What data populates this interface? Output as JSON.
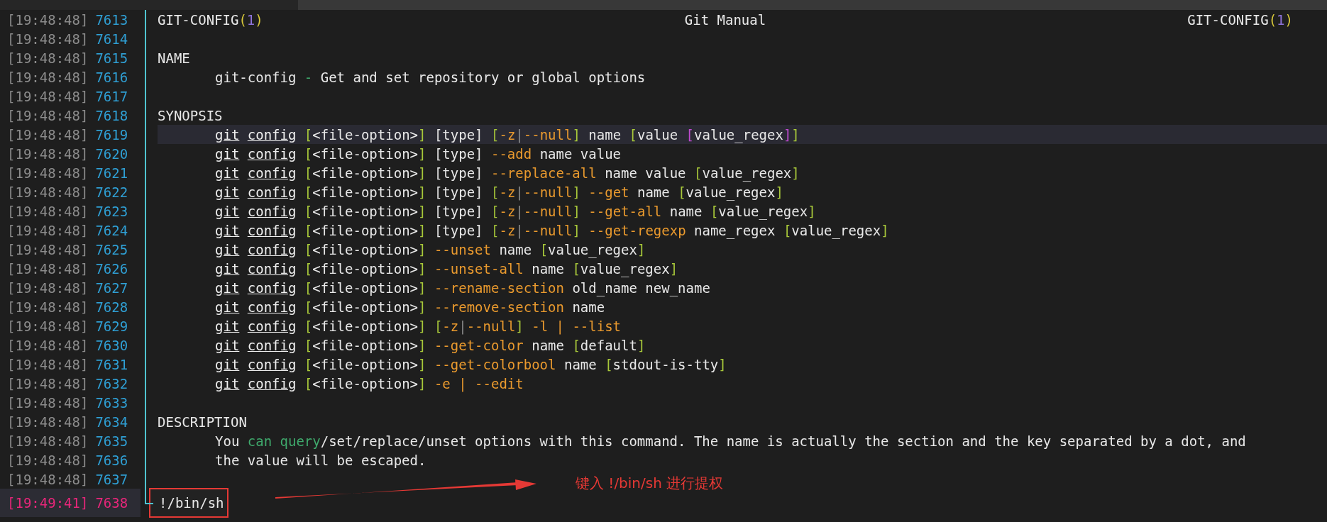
{
  "rows": [
    {
      "time": "[19:48:48]",
      "number": "7613",
      "kind": "header",
      "current": false,
      "highlighted": false,
      "header": [
        [
          {
            "kind": "text",
            "text": "GIT-CONFIG"
          },
          {
            "kind": "paren",
            "text": "("
          },
          {
            "kind": "num",
            "text": "1"
          },
          {
            "kind": "paren",
            "text": ")"
          }
        ],
        [
          {
            "kind": "text",
            "text": "Git Manual"
          }
        ],
        [
          {
            "kind": "text",
            "text": "GIT-CONFIG"
          },
          {
            "kind": "paren",
            "text": "("
          },
          {
            "kind": "num",
            "text": "1"
          },
          {
            "kind": "paren",
            "text": ")"
          }
        ]
      ]
    },
    {
      "time": "[19:48:48]",
      "number": "7614",
      "kind": "blank",
      "current": false,
      "highlighted": false
    },
    {
      "time": "[19:48:48]",
      "number": "7615",
      "kind": "text",
      "indented": false,
      "current": false,
      "highlighted": false,
      "segments": [
        {
          "kind": "text",
          "text": "NAME"
        }
      ]
    },
    {
      "time": "[19:48:48]",
      "number": "7616",
      "kind": "text",
      "indented": true,
      "current": false,
      "highlighted": false,
      "segments": [
        {
          "kind": "text",
          "text": "git-config "
        },
        {
          "kind": "green",
          "text": "-"
        },
        {
          "kind": "text",
          "text": " Get and set repository or global options"
        }
      ]
    },
    {
      "time": "[19:48:48]",
      "number": "7617",
      "kind": "blank",
      "current": false,
      "highlighted": false
    },
    {
      "time": "[19:48:48]",
      "number": "7618",
      "kind": "text",
      "indented": false,
      "current": false,
      "highlighted": false,
      "segments": [
        {
          "kind": "text",
          "text": "SYNOPSIS"
        }
      ]
    },
    {
      "time": "[19:48:48]",
      "number": "7619",
      "kind": "text",
      "indented": true,
      "current": false,
      "highlighted": true,
      "segments": [
        {
          "kind": "cmd",
          "text": "git"
        },
        {
          "kind": "cmd",
          "text": "config"
        },
        {
          "kind": "bracket",
          "text": "["
        },
        {
          "kind": "text",
          "text": "<file-option>"
        },
        {
          "kind": "bracket",
          "text": "]"
        },
        {
          "kind": "text",
          "text": " [type] "
        },
        {
          "kind": "bracket",
          "text": "["
        },
        {
          "kind": "option",
          "text": "-z"
        },
        {
          "kind": "dim",
          "text": "|"
        },
        {
          "kind": "option",
          "text": "--null"
        },
        {
          "kind": "bracket",
          "text": "]"
        },
        {
          "kind": "text",
          "text": " name "
        },
        {
          "kind": "bracket",
          "text": "["
        },
        {
          "kind": "text",
          "text": "value "
        },
        {
          "kind": "nested",
          "text": "["
        },
        {
          "kind": "text",
          "text": "value_regex"
        },
        {
          "kind": "nested",
          "text": "]"
        },
        {
          "kind": "bracket",
          "text": "]"
        }
      ]
    },
    {
      "time": "[19:48:48]",
      "number": "7620",
      "kind": "text",
      "indented": true,
      "current": false,
      "highlighted": false,
      "segments": [
        {
          "kind": "cmd",
          "text": "git"
        },
        {
          "kind": "cmd",
          "text": "config"
        },
        {
          "kind": "bracket",
          "text": "["
        },
        {
          "kind": "text",
          "text": "<file-option>"
        },
        {
          "kind": "bracket",
          "text": "]"
        },
        {
          "kind": "text",
          "text": " [type] "
        },
        {
          "kind": "option",
          "text": "--add"
        },
        {
          "kind": "text",
          "text": " name value"
        }
      ]
    },
    {
      "time": "[19:48:48]",
      "number": "7621",
      "kind": "text",
      "indented": true,
      "current": false,
      "highlighted": false,
      "segments": [
        {
          "kind": "cmd",
          "text": "git"
        },
        {
          "kind": "cmd",
          "text": "config"
        },
        {
          "kind": "bracket",
          "text": "["
        },
        {
          "kind": "text",
          "text": "<file-option>"
        },
        {
          "kind": "bracket",
          "text": "]"
        },
        {
          "kind": "text",
          "text": " [type] "
        },
        {
          "kind": "option",
          "text": "--replace-all"
        },
        {
          "kind": "text",
          "text": " name value "
        },
        {
          "kind": "bracket",
          "text": "["
        },
        {
          "kind": "text",
          "text": "value_regex"
        },
        {
          "kind": "bracket",
          "text": "]"
        }
      ]
    },
    {
      "time": "[19:48:48]",
      "number": "7622",
      "kind": "text",
      "indented": true,
      "current": false,
      "highlighted": false,
      "segments": [
        {
          "kind": "cmd",
          "text": "git"
        },
        {
          "kind": "cmd",
          "text": "config"
        },
        {
          "kind": "bracket",
          "text": "["
        },
        {
          "kind": "text",
          "text": "<file-option>"
        },
        {
          "kind": "bracket",
          "text": "]"
        },
        {
          "kind": "text",
          "text": " [type] "
        },
        {
          "kind": "bracket",
          "text": "["
        },
        {
          "kind": "option",
          "text": "-z"
        },
        {
          "kind": "dim",
          "text": "|"
        },
        {
          "kind": "option",
          "text": "--null"
        },
        {
          "kind": "bracket",
          "text": "]"
        },
        {
          "kind": "option",
          "text": " --get"
        },
        {
          "kind": "text",
          "text": " name "
        },
        {
          "kind": "bracket",
          "text": "["
        },
        {
          "kind": "text",
          "text": "value_regex"
        },
        {
          "kind": "bracket",
          "text": "]"
        }
      ]
    },
    {
      "time": "[19:48:48]",
      "number": "7623",
      "kind": "text",
      "indented": true,
      "current": false,
      "highlighted": false,
      "segments": [
        {
          "kind": "cmd",
          "text": "git"
        },
        {
          "kind": "cmd",
          "text": "config"
        },
        {
          "kind": "bracket",
          "text": "["
        },
        {
          "kind": "text",
          "text": "<file-option>"
        },
        {
          "kind": "bracket",
          "text": "]"
        },
        {
          "kind": "text",
          "text": " [type] "
        },
        {
          "kind": "bracket",
          "text": "["
        },
        {
          "kind": "option",
          "text": "-z"
        },
        {
          "kind": "dim",
          "text": "|"
        },
        {
          "kind": "option",
          "text": "--null"
        },
        {
          "kind": "bracket",
          "text": "]"
        },
        {
          "kind": "option",
          "text": " --get-all"
        },
        {
          "kind": "text",
          "text": " name "
        },
        {
          "kind": "bracket",
          "text": "["
        },
        {
          "kind": "text",
          "text": "value_regex"
        },
        {
          "kind": "bracket",
          "text": "]"
        }
      ]
    },
    {
      "time": "[19:48:48]",
      "number": "7624",
      "kind": "text",
      "indented": true,
      "current": false,
      "highlighted": false,
      "segments": [
        {
          "kind": "cmd",
          "text": "git"
        },
        {
          "kind": "cmd",
          "text": "config"
        },
        {
          "kind": "bracket",
          "text": "["
        },
        {
          "kind": "text",
          "text": "<file-option>"
        },
        {
          "kind": "bracket",
          "text": "]"
        },
        {
          "kind": "text",
          "text": " [type] "
        },
        {
          "kind": "bracket",
          "text": "["
        },
        {
          "kind": "option",
          "text": "-z"
        },
        {
          "kind": "dim",
          "text": "|"
        },
        {
          "kind": "option",
          "text": "--null"
        },
        {
          "kind": "bracket",
          "text": "]"
        },
        {
          "kind": "option",
          "text": " --get-regexp"
        },
        {
          "kind": "text",
          "text": " name_regex "
        },
        {
          "kind": "bracket",
          "text": "["
        },
        {
          "kind": "text",
          "text": "value_regex"
        },
        {
          "kind": "bracket",
          "text": "]"
        }
      ]
    },
    {
      "time": "[19:48:48]",
      "number": "7625",
      "kind": "text",
      "indented": true,
      "current": false,
      "highlighted": false,
      "segments": [
        {
          "kind": "cmd",
          "text": "git"
        },
        {
          "kind": "cmd",
          "text": "config"
        },
        {
          "kind": "bracket",
          "text": "["
        },
        {
          "kind": "text",
          "text": "<file-option>"
        },
        {
          "kind": "bracket",
          "text": "]"
        },
        {
          "kind": "option",
          "text": " --unset"
        },
        {
          "kind": "text",
          "text": " name "
        },
        {
          "kind": "bracket",
          "text": "["
        },
        {
          "kind": "text",
          "text": "value_regex"
        },
        {
          "kind": "bracket",
          "text": "]"
        }
      ]
    },
    {
      "time": "[19:48:48]",
      "number": "7626",
      "kind": "text",
      "indented": true,
      "current": false,
      "highlighted": false,
      "segments": [
        {
          "kind": "cmd",
          "text": "git"
        },
        {
          "kind": "cmd",
          "text": "config"
        },
        {
          "kind": "bracket",
          "text": "["
        },
        {
          "kind": "text",
          "text": "<file-option>"
        },
        {
          "kind": "bracket",
          "text": "]"
        },
        {
          "kind": "option",
          "text": " --unset-all"
        },
        {
          "kind": "text",
          "text": " name "
        },
        {
          "kind": "bracket",
          "text": "["
        },
        {
          "kind": "text",
          "text": "value_regex"
        },
        {
          "kind": "bracket",
          "text": "]"
        }
      ]
    },
    {
      "time": "[19:48:48]",
      "number": "7627",
      "kind": "text",
      "indented": true,
      "current": false,
      "highlighted": false,
      "segments": [
        {
          "kind": "cmd",
          "text": "git"
        },
        {
          "kind": "cmd",
          "text": "config"
        },
        {
          "kind": "bracket",
          "text": "["
        },
        {
          "kind": "text",
          "text": "<file-option>"
        },
        {
          "kind": "bracket",
          "text": "]"
        },
        {
          "kind": "option",
          "text": " --rename-section"
        },
        {
          "kind": "text",
          "text": " old_name new_name"
        }
      ]
    },
    {
      "time": "[19:48:48]",
      "number": "7628",
      "kind": "text",
      "indented": true,
      "current": false,
      "highlighted": false,
      "segments": [
        {
          "kind": "cmd",
          "text": "git"
        },
        {
          "kind": "cmd",
          "text": "config"
        },
        {
          "kind": "bracket",
          "text": "["
        },
        {
          "kind": "text",
          "text": "<file-option>"
        },
        {
          "kind": "bracket",
          "text": "]"
        },
        {
          "kind": "option",
          "text": " --remove-section"
        },
        {
          "kind": "text",
          "text": " name"
        }
      ]
    },
    {
      "time": "[19:48:48]",
      "number": "7629",
      "kind": "text",
      "indented": true,
      "current": false,
      "highlighted": false,
      "segments": [
        {
          "kind": "cmd",
          "text": "git"
        },
        {
          "kind": "cmd",
          "text": "config"
        },
        {
          "kind": "bracket",
          "text": "["
        },
        {
          "kind": "text",
          "text": "<file-option>"
        },
        {
          "kind": "bracket",
          "text": "] ["
        },
        {
          "kind": "option",
          "text": "-z"
        },
        {
          "kind": "dim",
          "text": "|"
        },
        {
          "kind": "option",
          "text": "--null"
        },
        {
          "kind": "bracket",
          "text": "]"
        },
        {
          "kind": "option",
          "text": " -l | --list"
        }
      ]
    },
    {
      "time": "[19:48:48]",
      "number": "7630",
      "kind": "text",
      "indented": true,
      "current": false,
      "highlighted": false,
      "segments": [
        {
          "kind": "cmd",
          "text": "git"
        },
        {
          "kind": "cmd",
          "text": "config"
        },
        {
          "kind": "bracket",
          "text": "["
        },
        {
          "kind": "text",
          "text": "<file-option>"
        },
        {
          "kind": "bracket",
          "text": "]"
        },
        {
          "kind": "option",
          "text": " --get-color"
        },
        {
          "kind": "text",
          "text": " name "
        },
        {
          "kind": "bracket",
          "text": "["
        },
        {
          "kind": "text",
          "text": "default"
        },
        {
          "kind": "bracket",
          "text": "]"
        }
      ]
    },
    {
      "time": "[19:48:48]",
      "number": "7631",
      "kind": "text",
      "indented": true,
      "current": false,
      "highlighted": false,
      "segments": [
        {
          "kind": "cmd",
          "text": "git"
        },
        {
          "kind": "cmd",
          "text": "config"
        },
        {
          "kind": "bracket",
          "text": "["
        },
        {
          "kind": "text",
          "text": "<file-option>"
        },
        {
          "kind": "bracket",
          "text": "]"
        },
        {
          "kind": "option",
          "text": " --get-colorbool"
        },
        {
          "kind": "text",
          "text": " name "
        },
        {
          "kind": "bracket",
          "text": "["
        },
        {
          "kind": "text",
          "text": "stdout-is-tty"
        },
        {
          "kind": "bracket",
          "text": "]"
        }
      ]
    },
    {
      "time": "[19:48:48]",
      "number": "7632",
      "kind": "text",
      "indented": true,
      "current": false,
      "highlighted": false,
      "segments": [
        {
          "kind": "cmd",
          "text": "git"
        },
        {
          "kind": "cmd",
          "text": "config"
        },
        {
          "kind": "bracket",
          "text": "["
        },
        {
          "kind": "text",
          "text": "<file-option>"
        },
        {
          "kind": "bracket",
          "text": "]"
        },
        {
          "kind": "option",
          "text": " -e | --edit"
        }
      ]
    },
    {
      "time": "[19:48:48]",
      "number": "7633",
      "kind": "blank",
      "current": false,
      "highlighted": false
    },
    {
      "time": "[19:48:48]",
      "number": "7634",
      "kind": "text",
      "indented": false,
      "current": false,
      "highlighted": false,
      "segments": [
        {
          "kind": "text",
          "text": "DESCRIPTION"
        }
      ]
    },
    {
      "time": "[19:48:48]",
      "number": "7635",
      "kind": "text",
      "indented": true,
      "current": false,
      "highlighted": false,
      "segments": [
        {
          "kind": "text",
          "text": "You "
        },
        {
          "kind": "green",
          "text": "can query"
        },
        {
          "kind": "text",
          "text": "/set/replace/unset options with this command. The name is actually the section and the key separated by a dot, and"
        }
      ]
    },
    {
      "time": "[19:48:48]",
      "number": "7636",
      "kind": "text",
      "indented": true,
      "current": false,
      "highlighted": false,
      "segments": [
        {
          "kind": "text",
          "text": "the value will be escaped."
        }
      ]
    },
    {
      "time": "[19:48:48]",
      "number": "7637",
      "kind": "blank",
      "current": false,
      "highlighted": false
    },
    {
      "time": "[19:49:41]",
      "number": "7638",
      "kind": "input",
      "current": true,
      "highlighted": false,
      "value": "!/bin/sh"
    }
  ],
  "annotation": "键入 !/bin/sh 进行提权"
}
